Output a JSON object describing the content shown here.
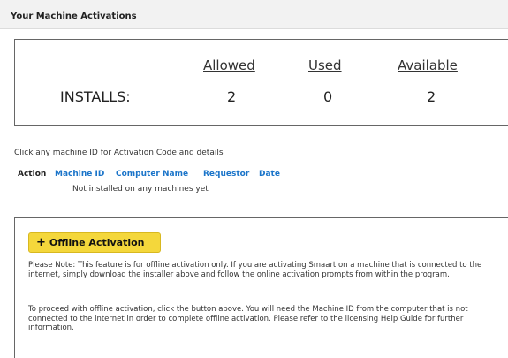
{
  "header": {
    "title": "Your Machine Activations"
  },
  "installs": {
    "label": "INSTALLS:",
    "columns": [
      {
        "heading": "Allowed",
        "value": "2"
      },
      {
        "heading": "Used",
        "value": "0"
      },
      {
        "heading": "Available",
        "value": "2"
      }
    ]
  },
  "hint_text": "Click any machine ID for Activation Code and details",
  "machines_table": {
    "columns": [
      "Action",
      "Machine ID",
      "Computer Name",
      "Requestor",
      "Date"
    ],
    "empty_text": "Not installed on any machines yet"
  },
  "offline": {
    "button_icon": "plus-icon",
    "button_label": "Offline Activation",
    "note_1": "Please Note: This feature is for offline activation only. If you are activating Smaart on a machine that is connected to the internet, simply download the installer above and follow the online activation prompts from within the program.",
    "note_2": "To proceed with offline activation, click the button above. You will need the Machine ID from the computer that is not connected to the internet in order to complete offline activation. Please refer to the licensing Help Guide for further information."
  },
  "colors": {
    "link": "#1a74c9",
    "button_bg": "#f4d73b",
    "border": "#666666"
  }
}
